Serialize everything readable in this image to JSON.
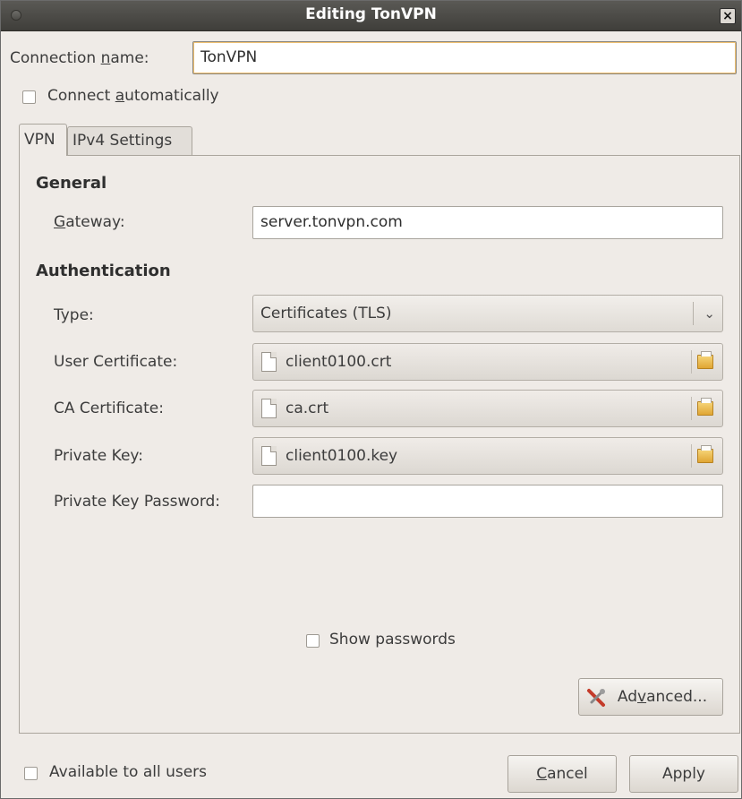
{
  "window": {
    "title": "Editing TonVPN",
    "close_glyph": "×"
  },
  "connection": {
    "name_label_pre": "Connection ",
    "name_label_u": "n",
    "name_label_post": "ame:",
    "name_value": "TonVPN",
    "auto_label_pre": "Connect ",
    "auto_label_u": "a",
    "auto_label_post": "utomatically",
    "auto_checked": false
  },
  "tabs": [
    {
      "label": "VPN",
      "active": true
    },
    {
      "label": "IPv4 Settings",
      "active": false
    }
  ],
  "general": {
    "heading": "General",
    "gateway_label_u": "G",
    "gateway_label_post": "ateway:",
    "gateway_value": "server.tonvpn.com"
  },
  "authentication": {
    "heading": "Authentication",
    "type_label": "Type:",
    "type_value": "Certificates (TLS)",
    "user_cert_label": "User Certificate:",
    "user_cert_value": "client0100.crt",
    "ca_cert_label": "CA Certificate:",
    "ca_cert_value": "ca.crt",
    "private_key_label": "Private Key:",
    "private_key_value": "client0100.key",
    "private_key_password_label": "Private Key Password:",
    "private_key_password_value": ""
  },
  "show_passwords": {
    "label": "Show passwords",
    "checked": false
  },
  "advanced": {
    "label_pre": "Ad",
    "label_u": "v",
    "label_post": "anced..."
  },
  "footer": {
    "available_label": "Available to all users",
    "available_checked": false,
    "cancel_u": "C",
    "cancel_post": "ancel",
    "apply_label": "Apply"
  },
  "icons": {
    "title_dot": "window-menu-icon",
    "close": "close-icon",
    "combo_arrow": "chevron-down-icon",
    "file": "file-icon",
    "folder": "folder-icon",
    "wrench": "wrench-screwdriver-icon"
  },
  "colors": {
    "titlebar": "#4a4945",
    "window_bg": "#efebe7",
    "folder": "#e8b54a"
  }
}
